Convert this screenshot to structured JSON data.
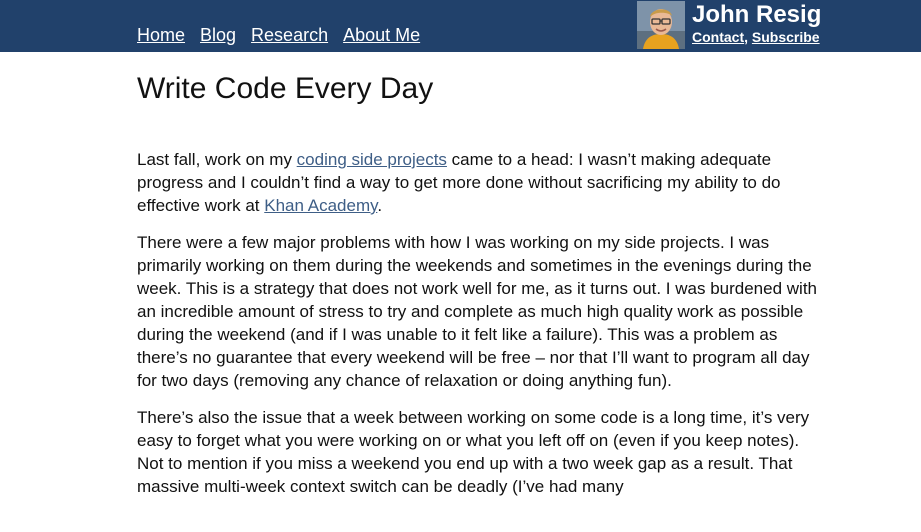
{
  "nav": {
    "items": [
      {
        "label": "Home"
      },
      {
        "label": "Blog"
      },
      {
        "label": "Research"
      },
      {
        "label": "About Me"
      }
    ]
  },
  "author": {
    "name": "John Resig",
    "contact_label": "Contact",
    "separator": ",",
    "subscribe_label": "Subscribe"
  },
  "post": {
    "title": "Write Code Every Day",
    "p1": {
      "t1": "Last fall, work on my ",
      "link1": "coding side projects",
      "t2": " came to a head: I wasn’t making adequate progress and I couldn’t find a way to get more done without sacrificing my ability to do effective work at ",
      "link2": "Khan Academy",
      "t3": "."
    },
    "p2": "There were a few major problems with how I was working on my side projects. I was primarily working on them during the weekends and sometimes in the evenings during the week. This is a strategy that does not work well for me, as it turns out. I was burdened with an incredible amount of stress to try and complete as much high quality work as possible during the weekend (and if I was unable to it felt like a failure). This was a problem as there’s no guarantee that every weekend will be free – nor that I’ll want to program all day for two days (removing any chance of relaxation or doing anything fun).",
    "p3": "There’s also the issue that a week between working on some code is a long time, it’s very easy to forget what you were working on or what you left off on (even if you keep notes). Not to mention if you miss a weekend you end up with a two week gap as a result. That massive multi-week context switch can be deadly (I’ve had many"
  },
  "colors": {
    "header_bg": "#21416b",
    "link": "#3e5e86"
  }
}
